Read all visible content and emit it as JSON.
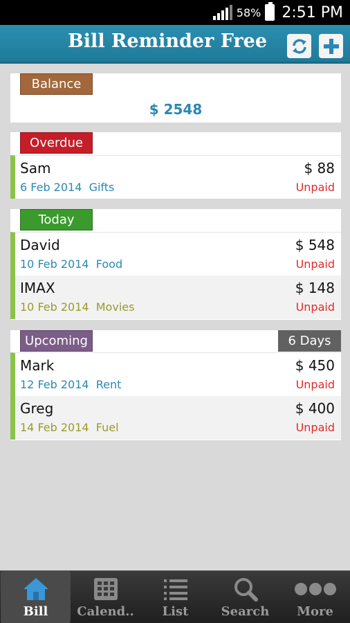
{
  "status_bar": {
    "battery_percent": "58%",
    "time": "2:51 PM"
  },
  "header": {
    "title": "Bill Reminder Free",
    "sync_icon": "sync-icon",
    "add_icon": "plus-icon"
  },
  "balance": {
    "label": "Balance",
    "amount": "$ 2548"
  },
  "overdue": {
    "label": "Overdue",
    "bills": [
      {
        "name": "Sam",
        "amount": "$ 88",
        "date": "6 Feb 2014",
        "category": "Gifts",
        "status": "Unpaid"
      }
    ]
  },
  "today": {
    "label": "Today",
    "bills": [
      {
        "name": "David",
        "amount": "$ 548",
        "date": "10 Feb 2014",
        "category": "Food",
        "status": "Unpaid"
      },
      {
        "name": "IMAX",
        "amount": "$ 148",
        "date": "10 Feb 2014",
        "category": "Movies",
        "status": "Unpaid"
      }
    ]
  },
  "upcoming": {
    "label": "Upcoming",
    "days_badge": "6 Days",
    "bills": [
      {
        "name": "Mark",
        "amount": "$ 450",
        "date": "12 Feb 2014",
        "category": "Rent",
        "status": "Unpaid"
      },
      {
        "name": "Greg",
        "amount": "$ 400",
        "date": "14 Feb 2014",
        "category": "Fuel",
        "status": "Unpaid"
      }
    ]
  },
  "bottom_nav": {
    "items": [
      {
        "label": "Bill",
        "icon": "home-icon",
        "active": true
      },
      {
        "label": "Calend..",
        "icon": "calendar-grid-icon",
        "active": false
      },
      {
        "label": "List",
        "icon": "list-icon",
        "active": false
      },
      {
        "label": "Search",
        "icon": "search-icon",
        "active": false
      },
      {
        "label": "More",
        "icon": "more-dots-icon",
        "active": false
      }
    ]
  },
  "colors": {
    "header_bg": "#2b8fb0",
    "balance_label": "#a2673a",
    "overdue_label": "#c61e28",
    "today_label": "#3a9a2c",
    "upcoming_label": "#7c5d88",
    "status_unpaid": "#e12a2a",
    "row_accent": "#8bc34a"
  }
}
